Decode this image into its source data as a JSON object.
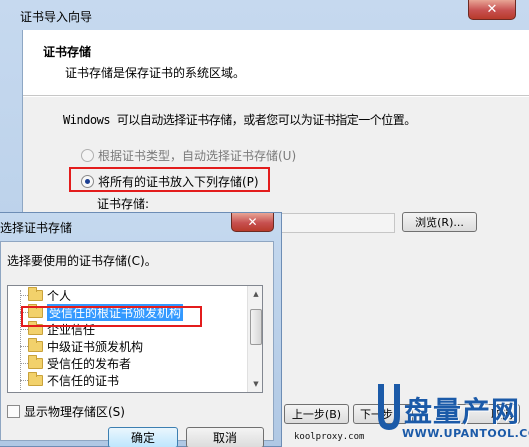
{
  "wizard": {
    "title": "证书导入向导",
    "close_glyph": "✕",
    "header_title": "证书存储",
    "header_subtitle": "证书存储是保存证书的系统区域。",
    "auto_text": "Windows 可以自动选择证书存储，或者您可以为证书指定一个位置。",
    "option_auto": "根据证书类型，自动选择证书存储(U)",
    "option_manual": "将所有的证书放入下列存储(P)",
    "store_label": "证书存储:",
    "browse_label": "浏览(R)...",
    "back_label": "上一步(B)",
    "next_label": "下一步",
    "cancel_label": "取消"
  },
  "dialog": {
    "title": "选择证书存储",
    "close_glyph": "✕",
    "prompt": "选择要使用的证书存储(C)。",
    "items": [
      "个人",
      "受信任的根证书颁发机构",
      "企业信任",
      "中级证书颁发机构",
      "受信任的发布者",
      "不信任的证书"
    ],
    "selected_index": 1,
    "show_physical_label": "显示物理存储区(S)",
    "ok_label": "确定",
    "cancel_label": "取消"
  },
  "watermark": {
    "cn": "盘量产网",
    "url": "WWW.UPANTOOL.COM",
    "site": "koolproxy.com"
  },
  "colors": {
    "highlight": "#e31c1c",
    "selection": "#3399ff",
    "watermark": "#1b5aa8"
  }
}
